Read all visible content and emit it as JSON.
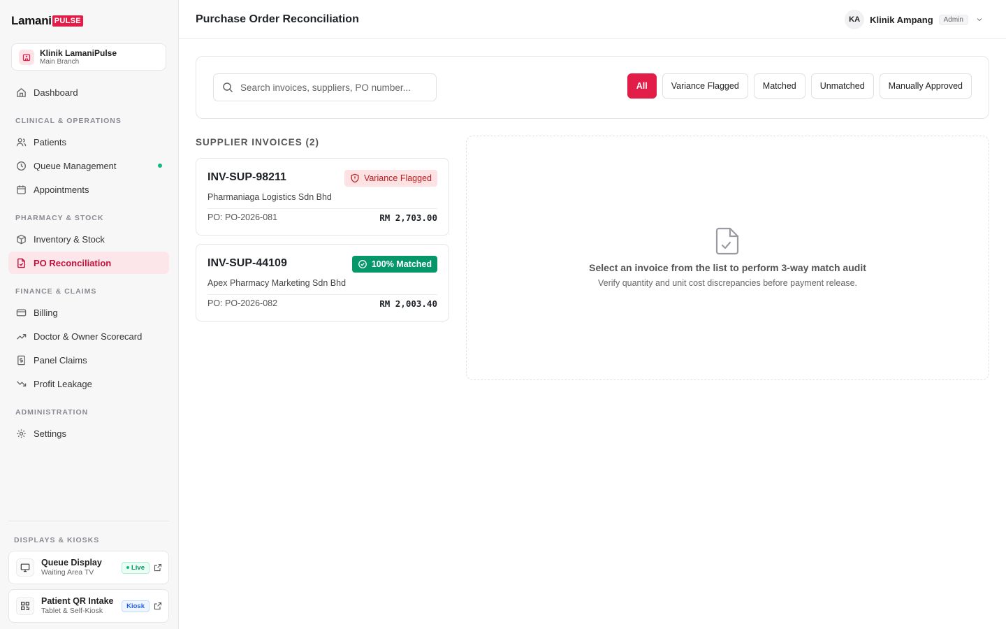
{
  "brand": {
    "name": "Lamani",
    "badge": "PULSE",
    "accent": "#e11d48"
  },
  "clinic": {
    "name": "Klinik LamaniPulse",
    "branch": "Main Branch"
  },
  "nav": {
    "dashboard": "Dashboard",
    "section_clinical": "CLINICAL & OPERATIONS",
    "patients": "Patients",
    "queue": "Queue Management",
    "appointments": "Appointments",
    "section_pharmacy": "PHARMACY & STOCK",
    "inventory": "Inventory & Stock",
    "po": "PO Reconciliation",
    "section_finance": "FINANCE & CLAIMS",
    "billing": "Billing",
    "scorecard": "Doctor & Owner Scorecard",
    "claims": "Panel Claims",
    "leakage": "Profit Leakage",
    "section_admin": "ADMINISTRATION",
    "settings": "Settings"
  },
  "kiosks": {
    "section": "DISPLAYS & KIOSKS",
    "queue_display": {
      "title": "Queue Display",
      "sub": "Waiting Area TV",
      "badge": "Live"
    },
    "qr_intake": {
      "title": "Patient QR Intake",
      "sub": "Tablet & Self-Kiosk",
      "badge": "Kiosk"
    }
  },
  "header": {
    "title": "Purchase Order Reconciliation",
    "user_initials": "KA",
    "user_name": "Klinik Ampang",
    "role": "Admin"
  },
  "search": {
    "placeholder": "Search invoices, suppliers, PO number..."
  },
  "filters": [
    "All",
    "Variance Flagged",
    "Matched",
    "Unmatched",
    "Manually Approved"
  ],
  "list_title": "SUPPLIER INVOICES (2)",
  "invoices": [
    {
      "id": "INV-SUP-98211",
      "status": "Variance Flagged",
      "supplier": "Pharmaniaga Logistics Sdn Bhd",
      "po": "PO: PO-2026-081",
      "amount": "RM 2,703.00"
    },
    {
      "id": "INV-SUP-44109",
      "status": "100% Matched",
      "supplier": "Apex Pharmacy Marketing Sdn Bhd",
      "po": "PO: PO-2026-082",
      "amount": "RM 2,003.40"
    }
  ],
  "empty": {
    "title": "Select an invoice from the list to perform 3-way match audit",
    "sub": "Verify quantity and unit cost discrepancies before payment release."
  }
}
